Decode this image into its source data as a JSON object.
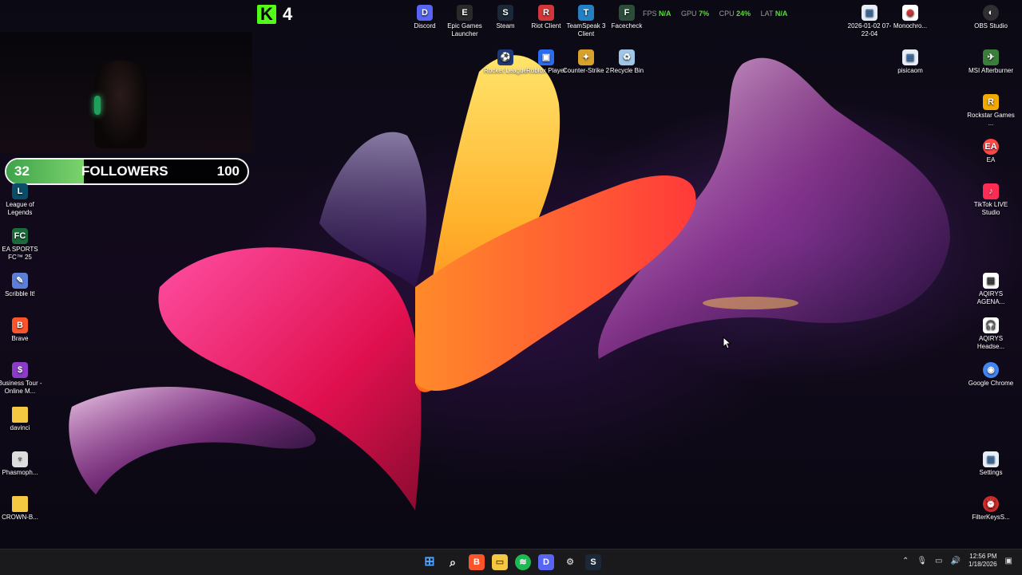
{
  "kick": {
    "count": "4"
  },
  "followers": {
    "current": "32",
    "label": "FOLLOWERS",
    "goal": "100",
    "progress": 0.32
  },
  "perf": {
    "fps_label": "FPS",
    "fps_value": "N/A",
    "gpu_label": "GPU",
    "gpu_value": "7%",
    "cpu_label": "CPU",
    "cpu_value": "24%",
    "lat_label": "LAT",
    "lat_value": "N/A"
  },
  "desktop_icons": {
    "discord": {
      "label": "Discord",
      "icon": "discord-icon",
      "color": "#5865f2"
    },
    "epic": {
      "label": "Epic Games Launcher",
      "icon": "epic-games-icon",
      "color": "#2a2a2a"
    },
    "steam": {
      "label": "Steam",
      "icon": "steam-icon",
      "color": "#1b2838"
    },
    "riot": {
      "label": "Riot Client",
      "icon": "riot-icon",
      "color": "#d13639"
    },
    "teamspeak": {
      "label": "TeamSpeak 3 Client",
      "icon": "teamspeak-icon",
      "color": "#2580c3"
    },
    "facecheck": {
      "label": "Facecheck",
      "icon": "facecheck-icon",
      "color": "#2b4d3a"
    },
    "screenshot": {
      "label": "2026-01-02 07-22-04",
      "icon": "file-icon",
      "color": "#e8eef7"
    },
    "monochrome": {
      "label": "Monochro...",
      "icon": "chrome-icon",
      "color": "#ffffff"
    },
    "obs": {
      "label": "OBS Studio",
      "icon": "obs-icon",
      "color": "#302e31"
    },
    "rocket": {
      "label": "Rocket League",
      "icon": "rocket-league-icon",
      "color": "#1e3a7a"
    },
    "roblox": {
      "label": "Roblox Player",
      "icon": "roblox-icon",
      "color": "#2a6cf0"
    },
    "cs2": {
      "label": "Counter-Strike 2",
      "icon": "counter-strike-icon",
      "color": "#d8a12b"
    },
    "recycle": {
      "label": "Recycle Bin",
      "icon": "recycle-bin-icon",
      "color": "#9fc6e8"
    },
    "pisicaom": {
      "label": "pisicaom",
      "icon": "file-icon",
      "color": "#e8eef7"
    },
    "msi": {
      "label": "MSI Afterburner",
      "icon": "msi-afterburner-icon",
      "color": "#3b7d3b"
    },
    "rockstar": {
      "label": "Rockstar Games ...",
      "icon": "rockstar-icon",
      "color": "#f2a900"
    },
    "ea": {
      "label": "EA",
      "icon": "ea-icon",
      "color": "#ff4747"
    },
    "tiktok": {
      "label": "TikTok LIVE Studio",
      "icon": "tiktok-icon",
      "color": "#fe2c55"
    },
    "aqirys1": {
      "label": "AQIRYS AGENA...",
      "icon": "aqirys-icon",
      "color": "#ffffff"
    },
    "aqirys2": {
      "label": "AQIRYS Headse...",
      "icon": "headset-icon",
      "color": "#ffffff"
    },
    "chrome": {
      "label": "Google Chrome",
      "icon": "chrome-icon",
      "color": "#4285f4"
    },
    "settings": {
      "label": "Settings",
      "icon": "settings-icon",
      "color": "#e8eef7"
    },
    "filterkeys": {
      "label": "FilterKeysS...",
      "icon": "filterkeys-icon",
      "color": "#d02b2b"
    },
    "lol": {
      "label": "League of Legends",
      "icon": "league-icon",
      "color": "#0a4d68"
    },
    "fc25": {
      "label": "EA SPORTS FC™ 25",
      "icon": "fc25-icon",
      "color": "#1c6b3a"
    },
    "scribble": {
      "label": "Scribble It!",
      "icon": "scribble-icon",
      "color": "#5b7fd6"
    },
    "brave": {
      "label": "Brave",
      "icon": "brave-icon",
      "color": "#fb542b"
    },
    "business": {
      "label": "Business Tour - Online M...",
      "icon": "business-tour-icon",
      "color": "#8a3bc8"
    },
    "davinci": {
      "label": "davinci",
      "icon": "folder-icon",
      "color": "#f5c842"
    },
    "phasmo": {
      "label": "Phasmoph...",
      "icon": "phasmophobia-icon",
      "color": "#dddddd"
    },
    "crown": {
      "label": "CROWN-B...",
      "icon": "folder-icon",
      "color": "#f5c842"
    }
  },
  "taskbar": {
    "apps": [
      "windows-start-icon",
      "search-icon",
      "brave-icon",
      "file-explorer-icon",
      "spotify-icon",
      "discord-icon",
      "steam-tool-icon",
      "steam-icon"
    ],
    "time": "12:56 PM",
    "date": "1/18/2026"
  }
}
